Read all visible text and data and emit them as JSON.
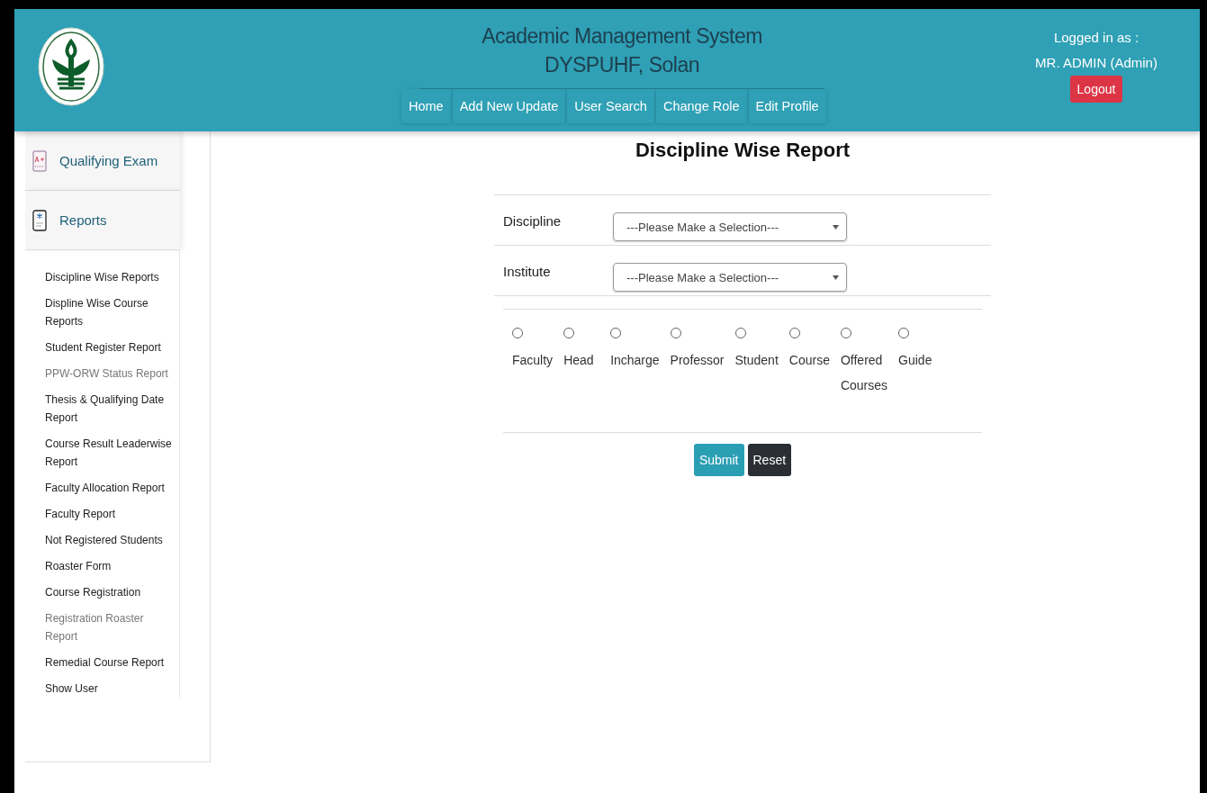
{
  "header": {
    "title_lines": [
      "Academic Management System",
      "DYSPUHF, Solan"
    ],
    "nav": [
      {
        "label": "Home"
      },
      {
        "label": "Add New Update"
      },
      {
        "label": "User Search"
      },
      {
        "label": "Change Role"
      },
      {
        "label": "Edit Profile"
      }
    ],
    "login": {
      "caption": "Logged in as :",
      "user": "MR. ADMIN (Admin)",
      "logout": "Logout"
    }
  },
  "sidebar": {
    "sections": [
      {
        "label": "Qualifying Exam",
        "kind": "exam"
      },
      {
        "label": "Reports",
        "kind": "report"
      }
    ],
    "items": [
      {
        "label": "Discipline Wise Reports",
        "dimmed": false
      },
      {
        "label": "Displine Wise Course Reports",
        "dimmed": false
      },
      {
        "label": "Student Register Report",
        "dimmed": false
      },
      {
        "label": "PPW-ORW Status Report",
        "dimmed": true
      },
      {
        "label": "Thesis & Qualifying Date Report",
        "dimmed": false
      },
      {
        "label": "Course Result Leaderwise Report",
        "dimmed": false
      },
      {
        "label": "Faculty Allocation Report",
        "dimmed": false
      },
      {
        "label": "Faculty Report",
        "dimmed": false
      },
      {
        "label": "Not Registered Students",
        "dimmed": false
      },
      {
        "label": "Roaster Form",
        "dimmed": false
      },
      {
        "label": "Course Registration",
        "dimmed": false
      },
      {
        "label": "Registration Roaster Report",
        "dimmed": true
      },
      {
        "label": "Remedial Course Report",
        "dimmed": false
      },
      {
        "label": "Show User",
        "dimmed": false
      }
    ]
  },
  "form": {
    "title": "Discipline Wise Report",
    "fields": [
      {
        "label": "Discipline",
        "value": "---Please Make a Selection---"
      },
      {
        "label": "Institute",
        "value": "---Please Make a Selection---"
      }
    ],
    "options": [
      {
        "label": "Faculty",
        "checked": false
      },
      {
        "label": "Head",
        "checked": false
      },
      {
        "label": "Incharge",
        "checked": false
      },
      {
        "label": "Professor",
        "checked": false
      },
      {
        "label": "Student",
        "checked": false
      },
      {
        "label": "Course",
        "checked": false
      },
      {
        "label": "Offered Courses",
        "checked": false
      },
      {
        "label": "Guide",
        "checked": false
      }
    ],
    "buttons": [
      {
        "label": "Submit",
        "kind": "primary"
      },
      {
        "label": "Reset",
        "kind": "dark"
      }
    ]
  }
}
